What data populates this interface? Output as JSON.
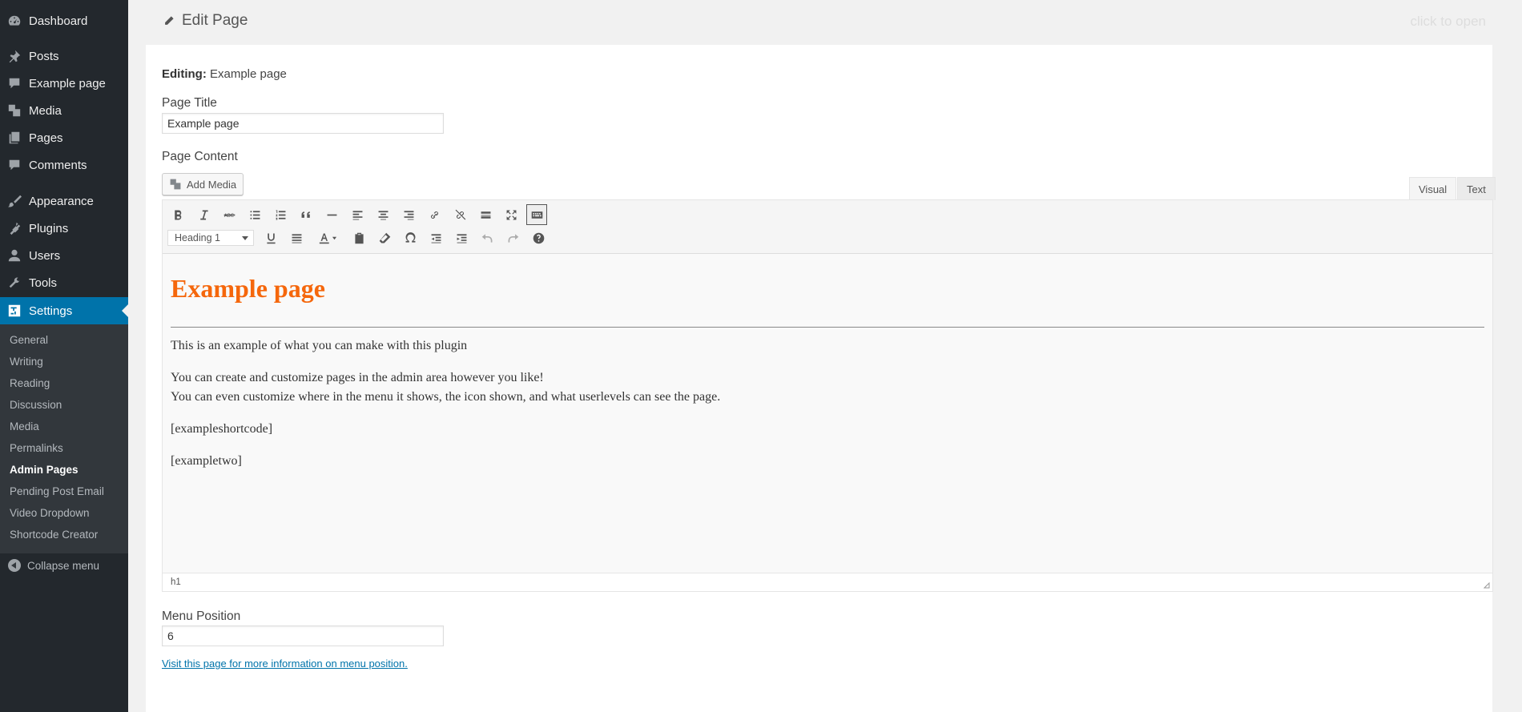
{
  "sidebar": {
    "items": [
      {
        "label": "Dashboard",
        "icon": "dashboard-icon"
      },
      {
        "label": "Posts",
        "icon": "pin-icon"
      },
      {
        "label": "Example page",
        "icon": "comment-icon"
      },
      {
        "label": "Media",
        "icon": "media-icon"
      },
      {
        "label": "Pages",
        "icon": "pages-icon"
      },
      {
        "label": "Comments",
        "icon": "comment-icon"
      },
      {
        "label": "Appearance",
        "icon": "brush-icon"
      },
      {
        "label": "Plugins",
        "icon": "plug-icon"
      },
      {
        "label": "Users",
        "icon": "user-icon"
      },
      {
        "label": "Tools",
        "icon": "wrench-icon"
      },
      {
        "label": "Settings",
        "icon": "settings-icon"
      }
    ],
    "submenu": [
      "General",
      "Writing",
      "Reading",
      "Discussion",
      "Media",
      "Permalinks",
      "Admin Pages",
      "Pending Post Email",
      "Video Dropdown",
      "Shortcode Creator"
    ],
    "active_submenu": "Admin Pages",
    "collapse_label": "Collapse menu"
  },
  "header": {
    "title": "Edit Page",
    "click_to_open": "click to open"
  },
  "form": {
    "editing_label": "Editing:",
    "editing_value": "Example page",
    "page_title_label": "Page Title",
    "page_title_value": "Example page",
    "page_content_label": "Page Content",
    "add_media_label": "Add Media",
    "tab_visual": "Visual",
    "tab_text": "Text",
    "format_select_value": "Heading 1",
    "statusbar_path": "h1",
    "menu_position_label": "Menu Position",
    "menu_position_value": "6",
    "info_link": "Visit this page for more information on menu position."
  },
  "content": {
    "heading": "Example page",
    "p1": "This is an example of what you can make with this plugin",
    "p2a": "You can create and customize pages in the admin area however you like!",
    "p2b": "You can even customize where in the menu it shows, the icon shown, and what userlevels can see the page.",
    "p3": "[exampleshortcode]",
    "p4": "[exampletwo]"
  },
  "colors": {
    "sidebar_bg": "#23282d",
    "submenu_bg": "#32373c",
    "accent": "#0073aa",
    "heading_color": "#f5670c"
  }
}
